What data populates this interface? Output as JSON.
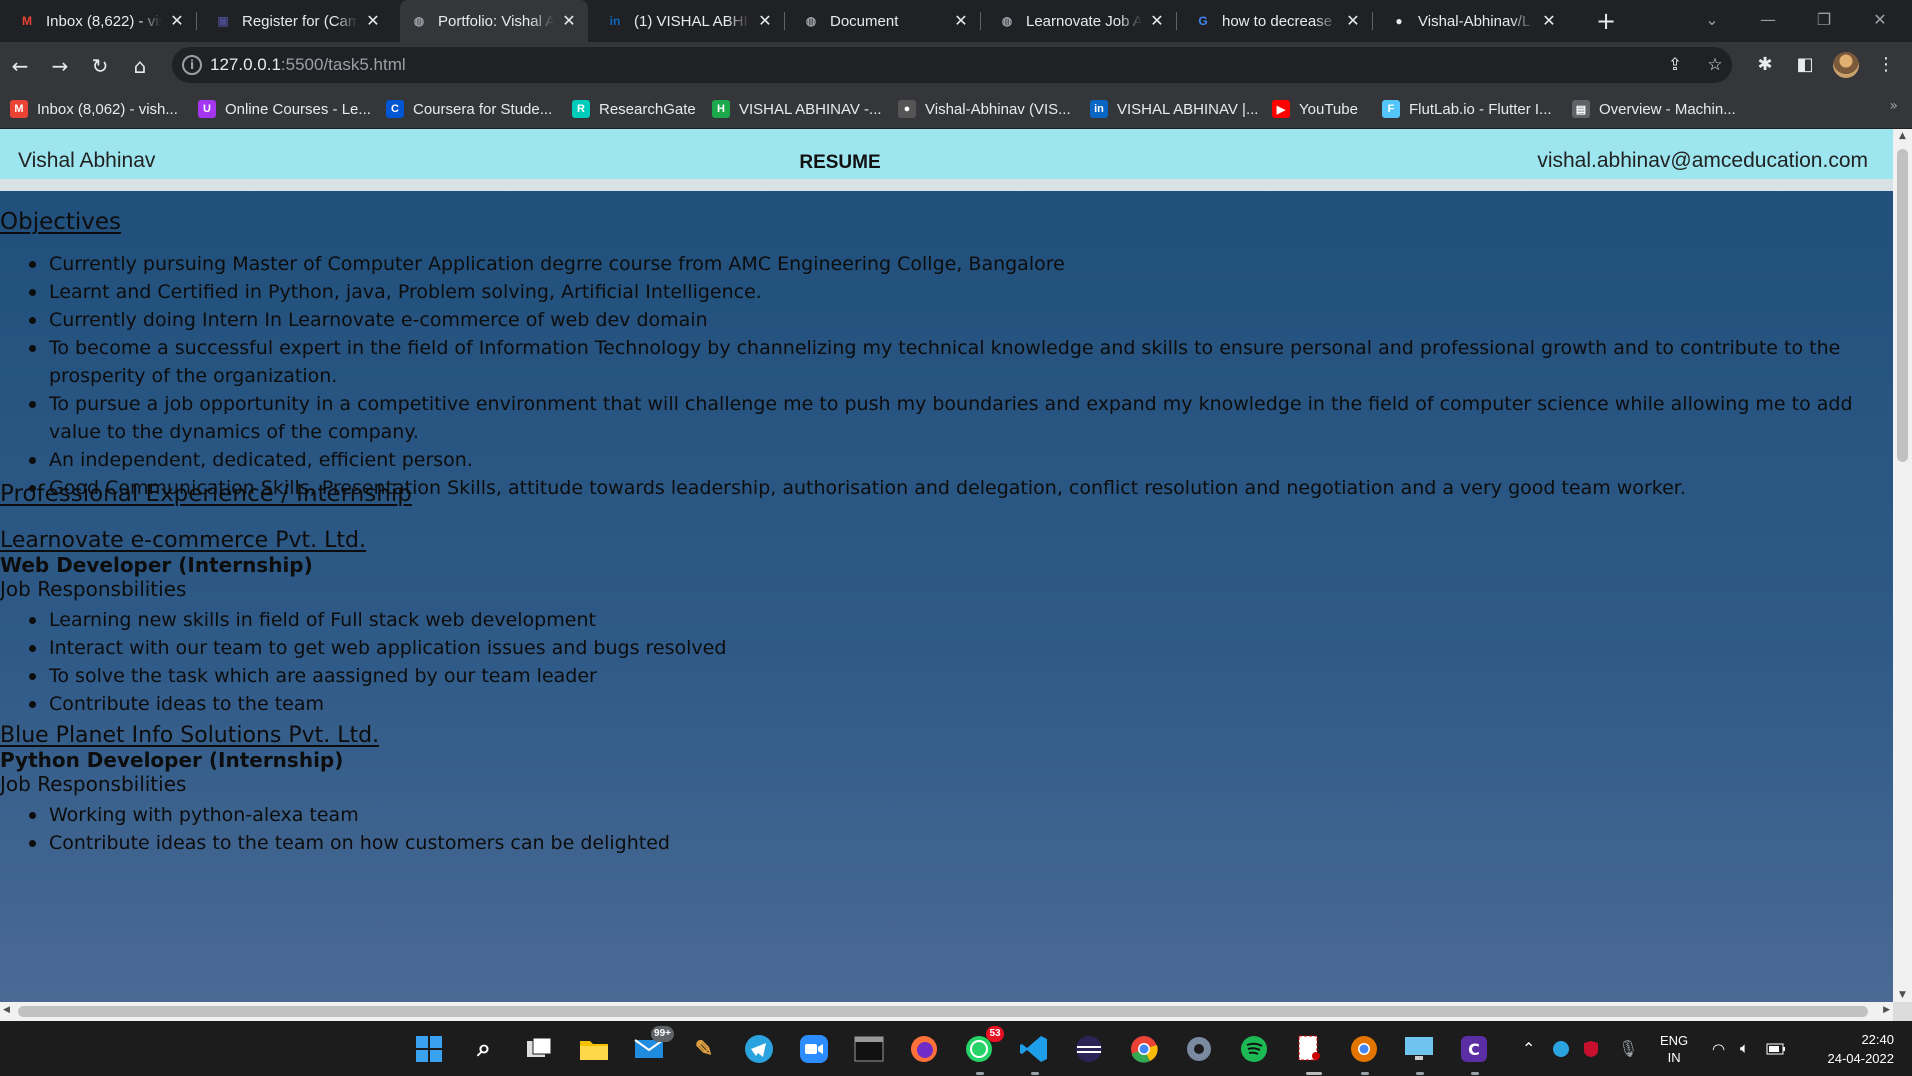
{
  "browser": {
    "tabs": [
      {
        "title": "Inbox (8,622) - vis",
        "icon": "gmail-icon",
        "glyph": "M",
        "color": "#ea4335"
      },
      {
        "title": "Register for (Camp",
        "icon": "doc-icon",
        "glyph": "▣",
        "color": "#4a4a8a"
      },
      {
        "title": "Portfolio: Vishal A",
        "icon": "globe-icon",
        "glyph": "◍",
        "color": "#9aa0a6",
        "active": true
      },
      {
        "title": "(1) VISHAL ABHIN",
        "icon": "linkedin-icon",
        "glyph": "in",
        "color": "#0a66c2"
      },
      {
        "title": "Document",
        "icon": "globe-icon",
        "glyph": "◍",
        "color": "#9aa0a6"
      },
      {
        "title": "Learnovate Job A",
        "icon": "globe-icon",
        "glyph": "◍",
        "color": "#9aa0a6"
      },
      {
        "title": "how to decrease",
        "icon": "google-icon",
        "glyph": "G",
        "color": "#4285f4"
      },
      {
        "title": "Vishal-Abhinav/L",
        "icon": "github-icon",
        "glyph": "●",
        "color": "#e8eaed"
      }
    ],
    "url_host": "127.0.0.1",
    "url_path": ":5500/task5.html",
    "bookmarks": [
      {
        "label": "Inbox (8,062) - vish...",
        "icon": "gmail-icon",
        "glyph": "M",
        "color": "#ea4335"
      },
      {
        "label": "Online Courses - Le...",
        "icon": "udemy-icon",
        "glyph": "U",
        "color": "#a435f0"
      },
      {
        "label": "Coursera for Stude...",
        "icon": "coursera-icon",
        "glyph": "C",
        "color": "#0056d2"
      },
      {
        "label": "ResearchGate",
        "icon": "researchgate-icon",
        "glyph": "R",
        "color": "#00ccbb"
      },
      {
        "label": "VISHAL ABHINAV -...",
        "icon": "hackerrank-icon",
        "glyph": "H",
        "color": "#1ba94c"
      },
      {
        "label": "Vishal-Abhinav (VIS...",
        "icon": "github-icon",
        "glyph": "●",
        "color": "#555555"
      },
      {
        "label": "VISHAL ABHINAV |...",
        "icon": "linkedin-icon",
        "glyph": "in",
        "color": "#0a66c2"
      },
      {
        "label": "YouTube",
        "icon": "youtube-icon",
        "glyph": "▶",
        "color": "#ff0000"
      },
      {
        "label": "FlutLab.io - Flutter I...",
        "icon": "flutter-icon",
        "glyph": "F",
        "color": "#54c5f8"
      },
      {
        "label": "Overview - Machin...",
        "icon": "overview-icon",
        "glyph": "▤",
        "color": "#5f6368"
      }
    ],
    "bookmarks_more": "»"
  },
  "page": {
    "header": {
      "name": "Vishal Abhinav",
      "title": "RESUME",
      "email": "vishal.abhinav@amceducation.com"
    },
    "objectives": {
      "heading": "Objectives",
      "items": [
        "Currently pursuing Master of Computer Application degrre course from AMC Engineering Collge, Bangalore",
        "Learnt and Certified in Python, java, Problem solving, Artificial Intelligence.",
        "Currently doing Intern In Learnovate e-commerce of web dev domain",
        "To become a successful expert in the field of Information Technology by channelizing my technical knowledge and skills to ensure personal and professional growth and to contribute to the prosperity of the organization.",
        "To pursue a job opportunity in a competitive environment that will challenge me to push my boundaries and expand my knowledge in the field of computer science while allowing me to add value to the dynamics of the company.",
        "An independent, dedicated, efficient person.",
        "Good Communication Skills, Presentation Skills, attitude towards leadership, authorisation and delegation, conflict resolution and negotiation and a very good team worker."
      ]
    },
    "experience": {
      "heading": "Professional Experience / Internship",
      "jobs": [
        {
          "company": "Learnovate e-commerce Pvt. Ltd.",
          "role": "Web Developer (Internship)",
          "resp_label": "Job Responsbilities",
          "items": [
            "Learning new skills in field of Full stack web development",
            "Interact with our team to get web application issues and bugs resolved",
            "To solve the task which are aassigned by our team leader",
            "Contribute ideas to the team"
          ]
        },
        {
          "company": "Blue Planet Info Solutions Pvt. Ltd.",
          "role": "Python Developer (Internship)",
          "resp_label": "Job Responsbilities",
          "items": [
            "Working with python-alexa team",
            "Contribute ideas to the team on how customers can be delighted"
          ]
        }
      ]
    }
  },
  "taskbar": {
    "mail_badge": "99+",
    "whatsapp_badge": "53",
    "lang_line1": "ENG",
    "lang_line2": "IN",
    "time": "22:40",
    "date": "24-04-2022"
  }
}
